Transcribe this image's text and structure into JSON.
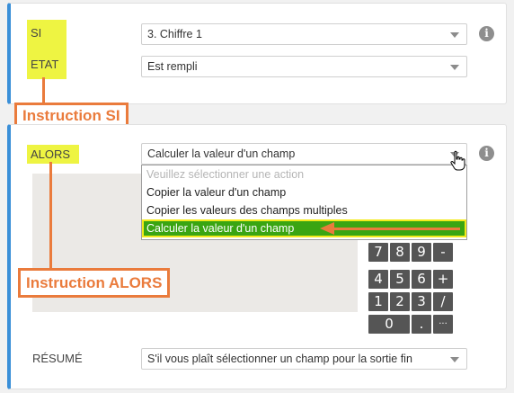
{
  "si_block": {
    "label_si": "SI",
    "label_etat": "ETAT",
    "select_si": "3. Chiffre 1",
    "select_etat": "Est rempli"
  },
  "alors_block": {
    "label_alors": "ALORS",
    "select_action": "Calculer la valeur d'un champ",
    "dropdown_options": [
      "Veuillez sélectionner une action",
      "Copier la valeur d'un champ",
      "Copier les valeurs des champs multiples",
      "Calculer la valeur d'un champ"
    ],
    "selected_option_index": 3,
    "label_resume": "RÉSUMÉ",
    "select_resume": "S'il vous plaît sélectionner un champ pour la sortie fin"
  },
  "keypad": {
    "rows": [
      [
        "7",
        "8",
        "9",
        "-"
      ],
      [
        "4",
        "5",
        "6",
        "+"
      ],
      [
        "1",
        "2",
        "3",
        "/"
      ],
      [
        "0",
        ".",
        "···"
      ]
    ]
  },
  "callouts": {
    "si": "Instruction SI",
    "alors": "Instruction ALORS"
  },
  "info_icon": "i",
  "icons": [
    "info-icon",
    "chevron-down-icon",
    "hand-pointer-icon"
  ],
  "colors": {
    "accent_border": "#3a8fd8",
    "highlight_yellow": "#eef442",
    "annotation_orange": "#ea7b3c",
    "selected_green": "#3aa512"
  }
}
